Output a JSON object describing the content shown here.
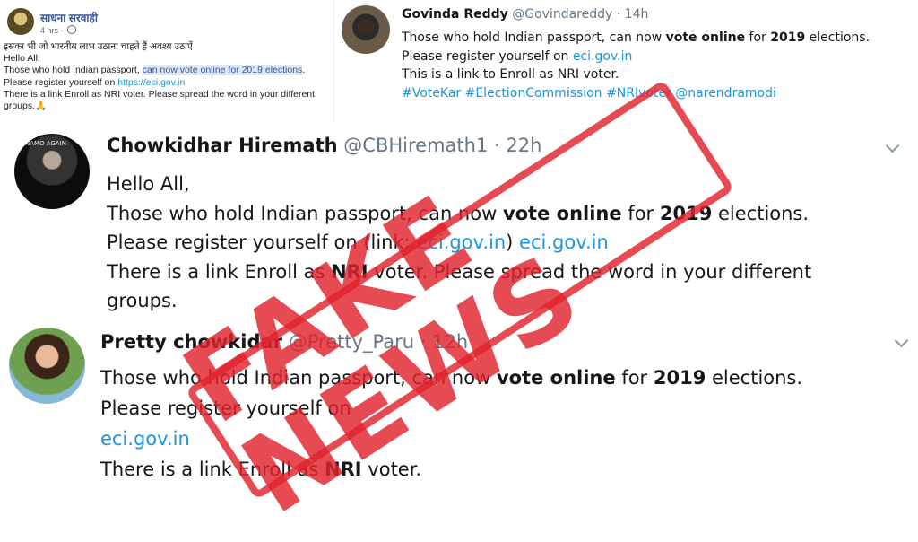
{
  "facebook_post": {
    "author": "साधना सरवाही",
    "time": "4 hrs",
    "lines": [
      "इसका भी जो भारतीय लाभ उठाना चाहते हैं अवश्य उठाऐं",
      "Hello All,",
      [
        "Those who hold Indian passport, ",
        "can now vote online for 2019 elections",
        "."
      ],
      [
        "Please register yourself on ",
        "https://eci.gov.in"
      ],
      "There is a link Enroll as NRI voter. Please spread the word in your different",
      "groups.🙏"
    ]
  },
  "tweets": [
    {
      "name": "Govinda Reddy",
      "handle": "@Govindareddy",
      "time": "14h",
      "line1": [
        "Those who hold Indian passport, can now ",
        "vote online",
        " for ",
        "2019",
        " elections."
      ],
      "line2": [
        "Please register yourself on ",
        "eci.gov.in"
      ],
      "line3": "This is a link to Enroll as NRI voter.",
      "hashtags": "#VoteKar #ElectionCommission #NRIvoter @narendramodi"
    },
    {
      "name": "Chowkidhar Hiremath",
      "handle": "@CBHiremath1",
      "time": "22h",
      "avatar_text": "NAMO AGAIN",
      "line1": "Hello All,",
      "line2": [
        "Those who hold Indian passport, can now ",
        "vote online",
        " for ",
        "2019",
        " elections."
      ],
      "line3": [
        "Please register yourself on (link: ",
        "eci.gov.in",
        ") ",
        "eci.gov.in"
      ],
      "line4": [
        "There is a link Enroll as ",
        "NRI",
        " voter. Please spread the word in your different"
      ],
      "line5": "groups."
    },
    {
      "name": "Pretty chowkidar",
      "handle": "@Pretty_Paru",
      "time": "12h",
      "line1": [
        "Those who hold Indian passport, can now ",
        "vote online",
        " for ",
        "2019",
        " elections."
      ],
      "line2": "Please register yourself on",
      "line3": "eci.gov.in",
      "line4": [
        "There is a link Enroll as ",
        "NRI",
        " voter."
      ]
    }
  ],
  "separator": "·",
  "stamp": {
    "text": "FAKE NEWS",
    "color": "#e1232d"
  },
  "colors": {
    "link": "#1b95e0",
    "muted": "#657786",
    "fb_name": "#385898"
  }
}
